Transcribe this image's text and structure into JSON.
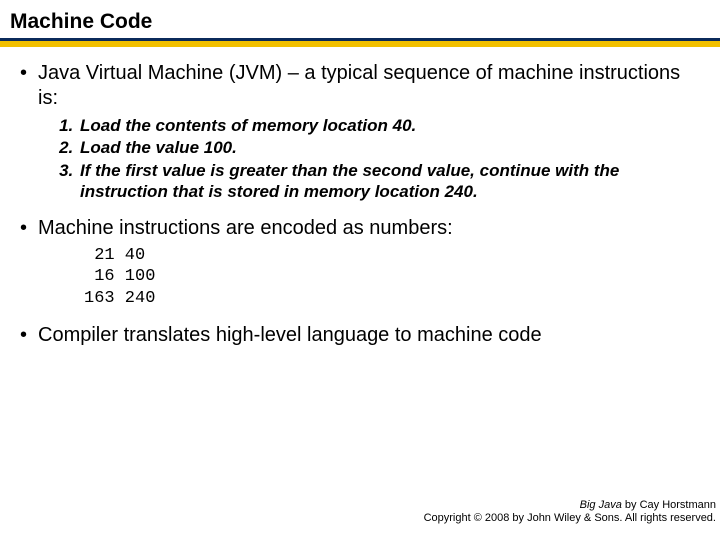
{
  "title": "Machine Code",
  "bullets": {
    "b1": "Java Virtual Machine (JVM) – a typical sequence of machine instructions is:",
    "b2": "Machine instructions are encoded as numbers:",
    "b3": "Compiler translates high-level language to machine code"
  },
  "steps": {
    "s1": "Load the contents of memory location 40.",
    "s2": "Load the value 100.",
    "s3": "If the first value is greater than the second value, continue with the instruction that is stored in memory location 240."
  },
  "code": " 21 40\n 16 100\n163 240",
  "footer": {
    "book": "Big Java",
    "author": " by Cay Horstmann",
    "copyright": "Copyright © 2008 by John Wiley & Sons. All rights reserved."
  }
}
